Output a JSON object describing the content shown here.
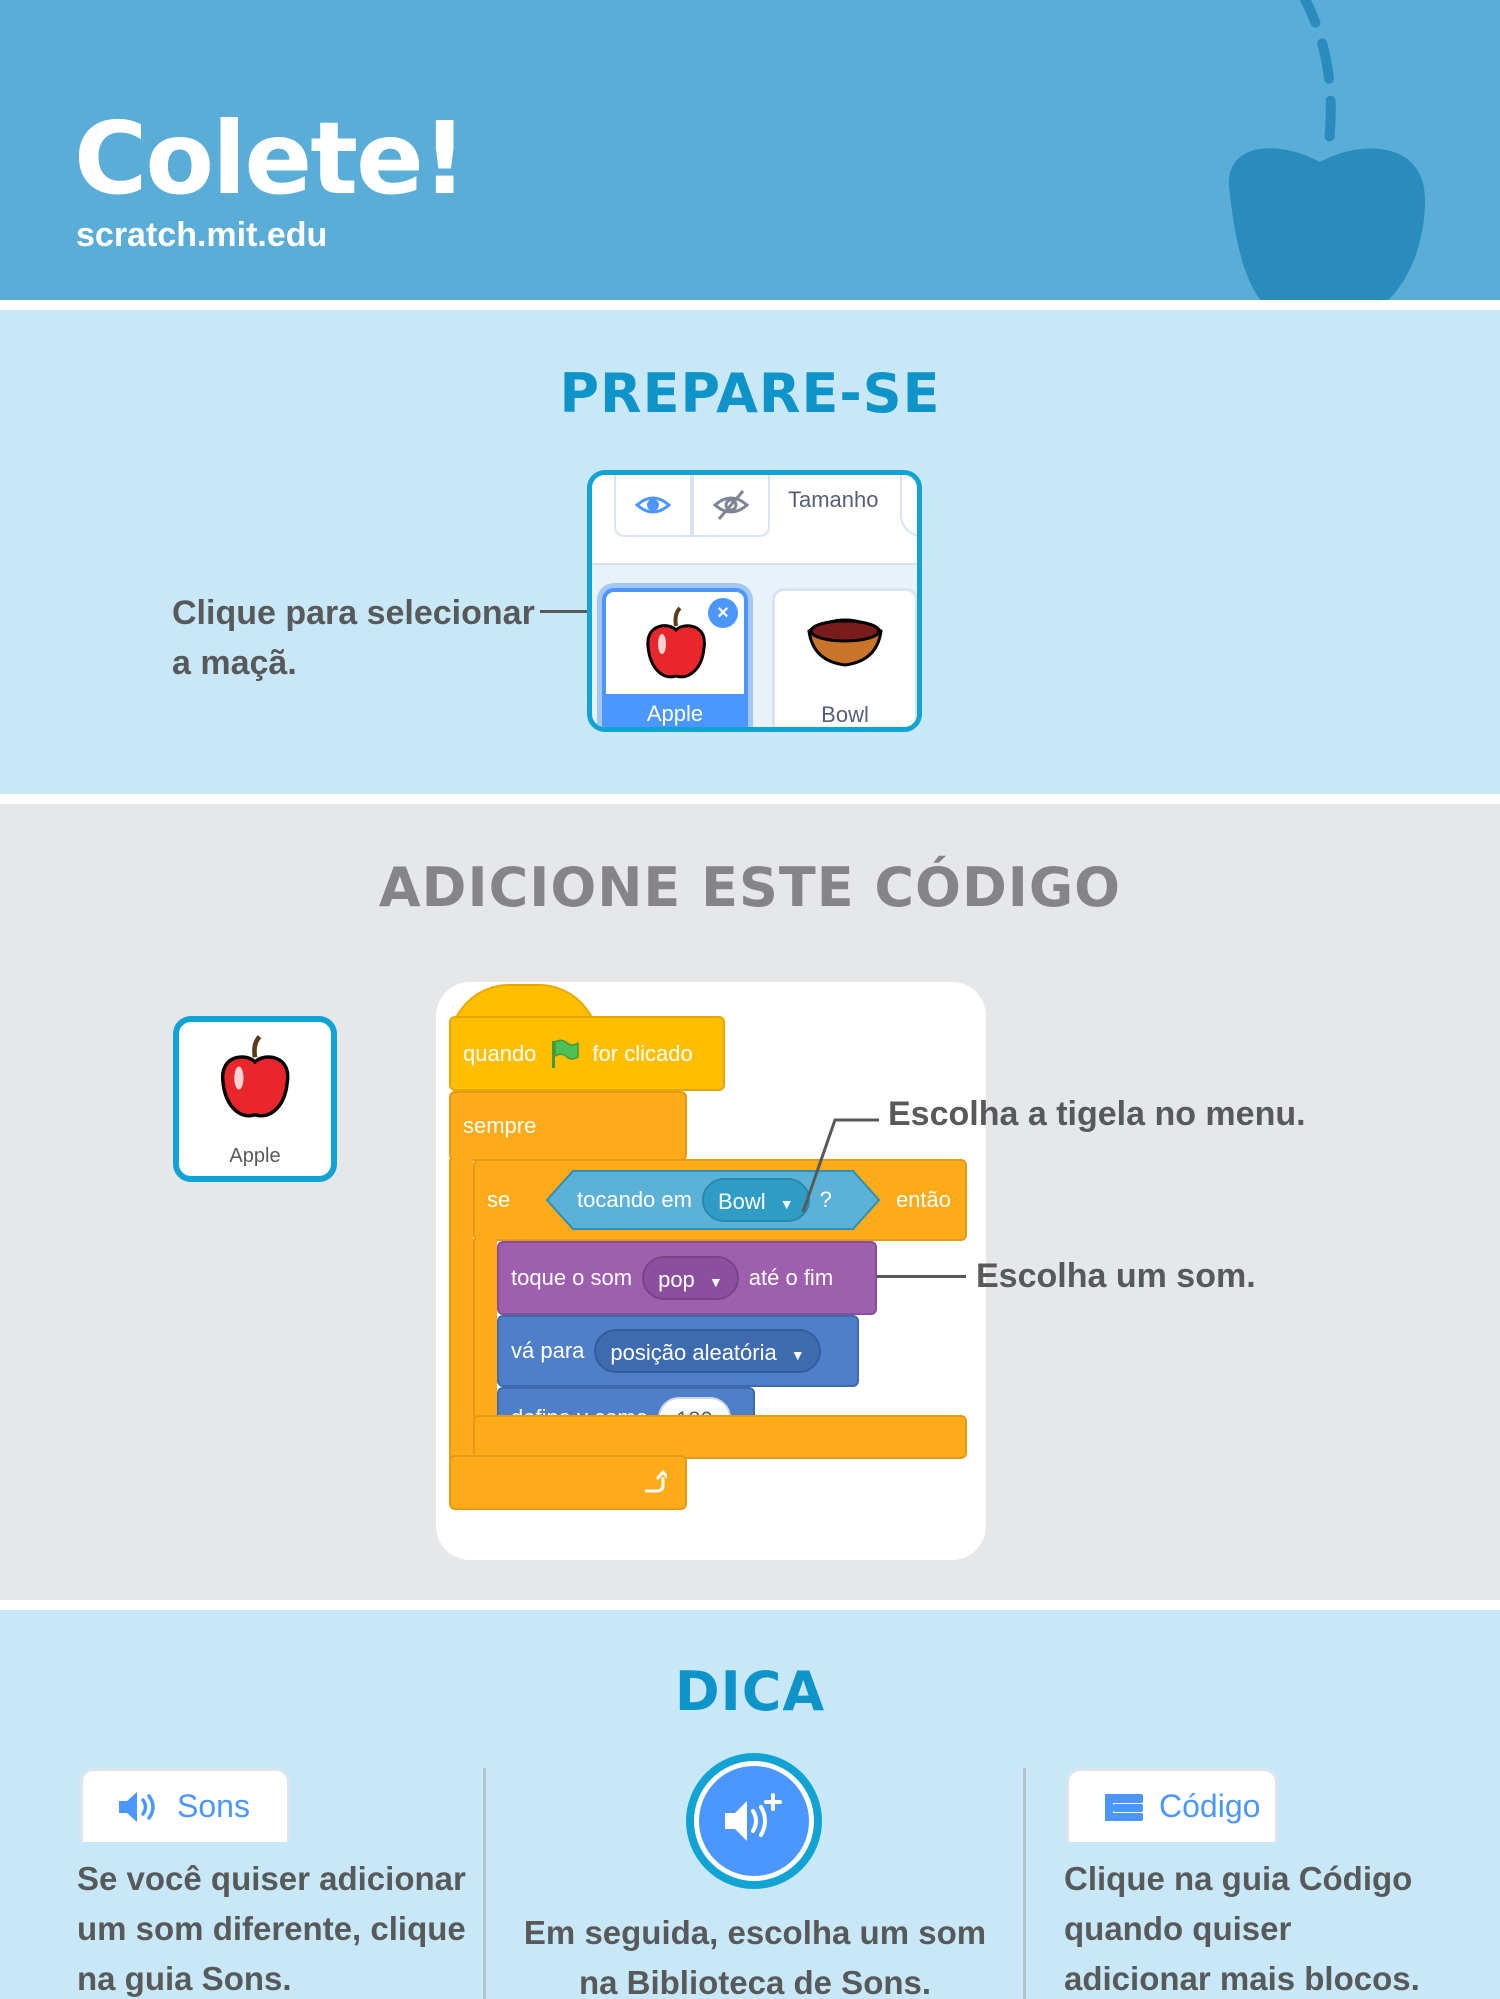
{
  "header": {
    "title": "Colete!",
    "url": "scratch.mit.edu",
    "bg_color": "#5aadd7",
    "decoration_icon": "apple-silhouette-icon"
  },
  "prepare": {
    "title": "PREPARE-SE",
    "callout_line1": "Clique para selecionar",
    "callout_line2": "a maçã.",
    "panel": {
      "show_icon": "eye-icon",
      "hide_icon": "eye-slash-icon",
      "size_label": "Tamanho",
      "sprites": [
        {
          "name": "Apple",
          "icon": "apple-icon",
          "selected": true,
          "delete_icon": "close-icon"
        },
        {
          "name": "Bowl",
          "icon": "bowl-icon",
          "selected": false
        }
      ]
    }
  },
  "code": {
    "title": "ADICIONE ESTE CÓDIGO",
    "sprite_card_label": "Apple",
    "callout_menu": "Escolha a tigela no menu.",
    "callout_sound": "Escolha um som.",
    "blocks": {
      "hat": {
        "before": "quando",
        "flag_icon": "green-flag-icon",
        "after": "for clicado"
      },
      "forever": {
        "label": "sempre",
        "loop_icon": "loop-arrow-icon"
      },
      "if": {
        "label": "se",
        "then": "então"
      },
      "touching": {
        "label": "tocando em",
        "menu": "Bowl",
        "question": "?"
      },
      "play_sound": {
        "label": "toque o som",
        "menu": "pop",
        "after": "até o fim"
      },
      "goto": {
        "label": "vá para",
        "menu": "posição aleatória"
      },
      "set_y": {
        "label": "defina y como",
        "value": "180"
      }
    },
    "colors": {
      "events": "#ffbf00",
      "control": "#ffab19",
      "sensing": "#5cb1d6",
      "sound": "#9e5fae",
      "motion": "#4e7fc8"
    }
  },
  "tip": {
    "title": "DICA",
    "sons_tab": "Sons",
    "sons_icon": "speaker-icon",
    "col1_text": [
      "Se você quiser adicionar",
      "um som diferente, clique",
      "na guia Sons."
    ],
    "add_sound_icon": "add-sound-icon",
    "col2_text": [
      "Em seguida, escolha um som",
      "na Biblioteca de Sons."
    ],
    "codigo_tab": "Código",
    "codigo_icon": "code-blocks-icon",
    "col3_text": [
      "Clique na guia Código",
      "quando quiser",
      "adicionar mais blocos."
    ]
  }
}
